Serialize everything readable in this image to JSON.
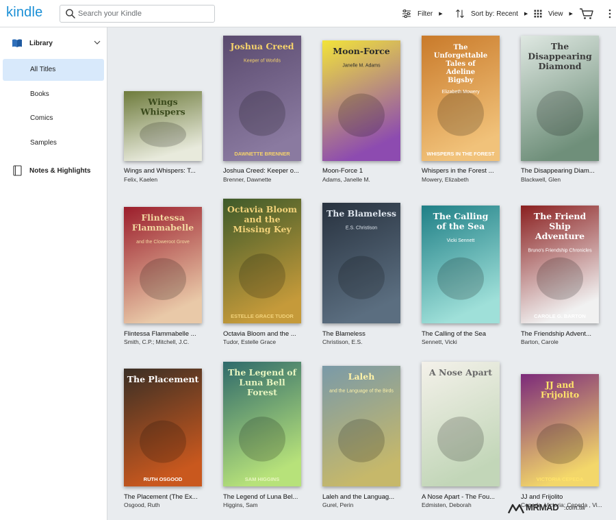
{
  "app": {
    "logo": "kindle"
  },
  "search": {
    "placeholder": "Search your Kindle"
  },
  "toolbar": {
    "filter_label": "Filter",
    "sort_label": "Sort by: Recent",
    "view_label": "View"
  },
  "sidebar": {
    "library_label": "Library",
    "items": [
      {
        "label": "All Titles",
        "active": true
      },
      {
        "label": "Books",
        "active": false
      },
      {
        "label": "Comics",
        "active": false
      },
      {
        "label": "Samples",
        "active": false
      }
    ],
    "notes_label": "Notes & Highlights"
  },
  "books": [
    {
      "title": "Wings and Whispers: T...",
      "author": "Felix, Kaelen",
      "cover_text": "Wings Whispers",
      "bg": "#6e7b3c",
      "bg2": "#e8eadc",
      "fg": "#3a4a1c"
    },
    {
      "title": "Joshua Creed: Keeper o...",
      "author": "Brenner, Dawnette",
      "cover_text": "Joshua Creed",
      "cover_sub": "Keeper of Worlds",
      "cover_foot": "Dawnette Brenner",
      "bg": "#5a4a6e",
      "bg2": "#8a7aa0",
      "fg": "#f6d36b"
    },
    {
      "title": "Moon-Force 1",
      "author": "Adams, Janelle M.",
      "cover_text": "Moon-Force",
      "cover_sub": "Janelle M. Adams",
      "bg": "#f2e43a",
      "bg2": "#8d4bb0",
      "fg": "#2b2b2b"
    },
    {
      "title": "Whispers in the Forest ...",
      "author": "Mowery, Elizabeth",
      "cover_text": "The Unforgettable Tales of Adeline Bigsby",
      "cover_sub": "Elizabeth Mowery",
      "cover_foot": "Whispers in the Forest",
      "bg": "#c97a2a",
      "bg2": "#f1c27a",
      "fg": "#ffffff"
    },
    {
      "title": "The Disappearing Diam...",
      "author": "Blackwell, Glen",
      "cover_text": "The Disappearing Diamond",
      "bg": "#dfe8e2",
      "bg2": "#6f8f7a",
      "fg": "#3b3b3b"
    },
    {
      "title": "Flintessa Flammabelle ...",
      "author": "Smith, C.P.; Mitchell, J.C.",
      "cover_text": "Flintessa Flammabelle",
      "cover_sub": "and the Cloweroot Grove",
      "bg": "#9b1d2b",
      "bg2": "#e9c9a8",
      "fg": "#f3d7a0"
    },
    {
      "title": "Octavia Bloom and the ...",
      "author": "Tudor, Estelle Grace",
      "cover_text": "Octavia Bloom and the Missing Key",
      "cover_foot": "Estelle Grace Tudor",
      "bg": "#3d5a2a",
      "bg2": "#c59a3a",
      "fg": "#f2d27a"
    },
    {
      "title": "The Blameless",
      "author": "Christison, E.S.",
      "cover_text": "The Blameless",
      "cover_sub": "E.S. Christison",
      "bg": "#28323f",
      "bg2": "#5b6e80",
      "fg": "#dfe6ee"
    },
    {
      "title": "The Calling of the Sea",
      "author": "Sennett, Vicki",
      "cover_text": "The Calling of the Sea",
      "cover_sub": "Vicki Sennett",
      "bg": "#1f7f86",
      "bg2": "#9fe0d9",
      "fg": "#ffffff"
    },
    {
      "title": "The Friendship Advent...",
      "author": "Barton, Carole",
      "cover_text": "The Friend Ship Adventure",
      "cover_sub": "Bruno's Friendship Chronicles",
      "cover_foot": "Carole G. Barton",
      "bg": "#8a1f1f",
      "bg2": "#f1f1f1",
      "fg": "#ffffff"
    },
    {
      "title": "The Placement (The Ex...",
      "author": "Osgood, Ruth",
      "cover_text": "The Placement",
      "cover_foot": "Ruth Osgood",
      "bg": "#3a2f25",
      "bg2": "#c9581e",
      "fg": "#ffffff"
    },
    {
      "title": "The Legend of Luna Bel...",
      "author": "Higgins, Sam",
      "cover_text": "The Legend of Luna Bell Forest",
      "cover_foot": "Sam Higgins",
      "bg": "#2f6a6b",
      "bg2": "#b7e27a",
      "fg": "#e8f5c0"
    },
    {
      "title": "Laleh and the Languag...",
      "author": "Gurel, Perin",
      "cover_text": "Laleh",
      "cover_sub": "and the Language of the Birds",
      "bg": "#7a9aa8",
      "bg2": "#c6b86a",
      "fg": "#fff2a8"
    },
    {
      "title": "A Nose Apart - The Fou...",
      "author": "Edmisten, Deborah",
      "cover_text": "A Nose Apart",
      "bg": "#f4f1ea",
      "bg2": "#c2d6b8",
      "fg": "#6a6a6a"
    },
    {
      "title": "JJ and Frijolito",
      "author": "Cepeda, Victoria; Cepeda , Vi...",
      "cover_text": "JJ and Frijolito",
      "cover_foot": "Victoria Cepeda",
      "bg": "#7c2a7a",
      "bg2": "#f3d76a",
      "fg": "#ffe36a"
    }
  ],
  "watermark": {
    "brand": "MRMAD",
    "domain": ".com.tw"
  }
}
